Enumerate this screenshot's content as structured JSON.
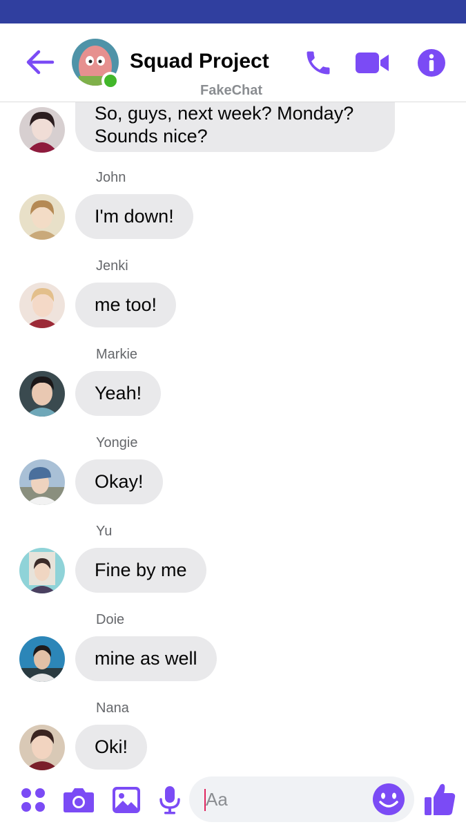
{
  "colors": {
    "accent": "#7b4bf5",
    "status_bar": "#303f9f",
    "bubble": "#e9e9eb",
    "online": "#42b72a"
  },
  "header": {
    "title": "Squad Project",
    "watermark": "FakeChat",
    "icons": [
      "back-arrow-icon",
      "phone-icon",
      "video-camera-icon",
      "info-icon"
    ]
  },
  "messages": [
    {
      "sender": "",
      "text": "So, guys, next week? Monday?\nSounds nice?"
    },
    {
      "sender": "John",
      "text": "I'm down!"
    },
    {
      "sender": "Jenki",
      "text": "me too!"
    },
    {
      "sender": "Markie",
      "text": "Yeah!"
    },
    {
      "sender": "Yongie",
      "text": "Okay!"
    },
    {
      "sender": "Yu",
      "text": "Fine by me"
    },
    {
      "sender": "Doie",
      "text": "mine as well"
    },
    {
      "sender": "Nana",
      "text": "Oki!"
    }
  ],
  "composer": {
    "placeholder": "Aa",
    "icons": [
      "menu-dots-icon",
      "camera-icon",
      "gallery-icon",
      "microphone-icon",
      "emoji-icon",
      "thumbs-up-icon"
    ]
  }
}
